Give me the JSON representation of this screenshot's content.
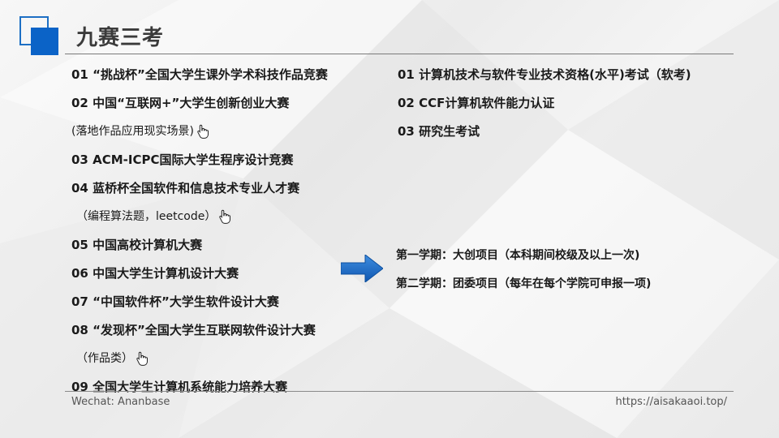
{
  "title": "九赛三考",
  "competitions": [
    {
      "text": "01 “挑战杯”全国大学生课外学术科技作品竞赛"
    },
    {
      "text": "02 中国“互联网+”大学生创新创业大赛"
    },
    {
      "text": "(落地作品应用现实场景)",
      "note": true,
      "icon": "hand-pointer-icon"
    },
    {
      "text": "03 ACM-ICPC国际大学生程序设计竞赛"
    },
    {
      "text": "04 蓝桥杯全国软件和信息技术专业人才赛"
    },
    {
      "text": "（编程算法题，leetcode）",
      "note": true,
      "icon": "hand-pointer-icon"
    },
    {
      "text": "05 中国高校计算机大赛"
    },
    {
      "text": "06 中国大学生计算机设计大赛"
    },
    {
      "text": "07 “中国软件杯”大学生软件设计大赛"
    },
    {
      "text": "08 “发现杯”全国大学生互联网软件设计大赛"
    },
    {
      "text": "（作品类）",
      "note": true,
      "icon": "hand-pointer-icon"
    },
    {
      "text": "09 全国大学生计算机系统能力培养大赛"
    }
  ],
  "exams": [
    "01 计算机技术与软件专业技术资格(水平)考试（软考)",
    "02 CCF计算机软件能力认证",
    "03 研究生考试"
  ],
  "projects": [
    "第一学期：大创项目（本科期间校级及以上一次)",
    "第二学期：团委项目（每年在每个学院可申报一项)"
  ],
  "footer": {
    "left": "Wechat: Ananbase",
    "right": "https://aisakaaoi.top/"
  },
  "colors": {
    "accent": "#0b63c7",
    "arrow": "#1565c0",
    "title": "#3a3a3a"
  }
}
